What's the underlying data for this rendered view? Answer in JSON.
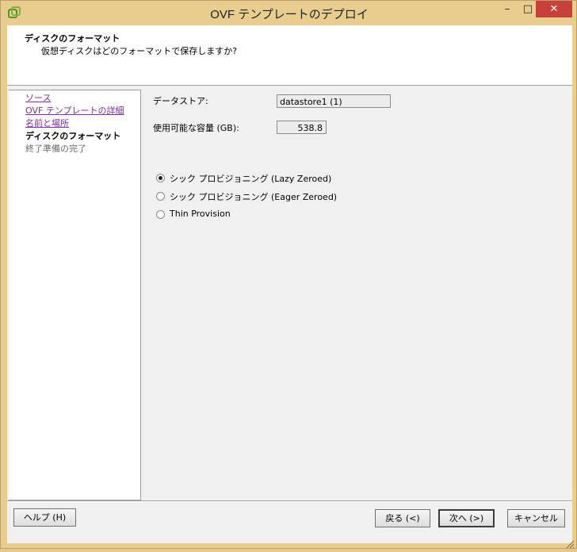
{
  "window": {
    "title": "OVF テンプレートのデプロイ",
    "minimize": "–",
    "maximize": "□",
    "close": "✕"
  },
  "header": {
    "title": "ディスクのフォーマット",
    "subtitle": "仮想ディスクはどのフォーマットで保存しますか?"
  },
  "nav": {
    "items": [
      {
        "label": "ソース",
        "state": "link"
      },
      {
        "label": "OVF テンプレートの詳細",
        "state": "link"
      },
      {
        "label": "名前と場所",
        "state": "link"
      },
      {
        "label": "ディスクのフォーマット",
        "state": "current"
      },
      {
        "label": "終了準備の完了",
        "state": "pending"
      }
    ]
  },
  "fields": {
    "datastore_label": "データストア:",
    "datastore_value": "datastore1 (1)",
    "capacity_label": "使用可能な容量 (GB):",
    "capacity_value": "538.8"
  },
  "options": [
    {
      "label": "シック プロビジョニング (Lazy Zeroed)",
      "selected": true
    },
    {
      "label": "シック プロビジョニング (Eager Zeroed)",
      "selected": false
    },
    {
      "label": "Thin Provision",
      "selected": false
    }
  ],
  "buttons": {
    "help": "ヘルプ (H)",
    "back": "戻る (<)",
    "next": "次へ (>)",
    "cancel": "キャンセル"
  },
  "colors": {
    "frame": "#e8cd8f",
    "close": "#c7403a",
    "link": "#7a2fa0"
  }
}
